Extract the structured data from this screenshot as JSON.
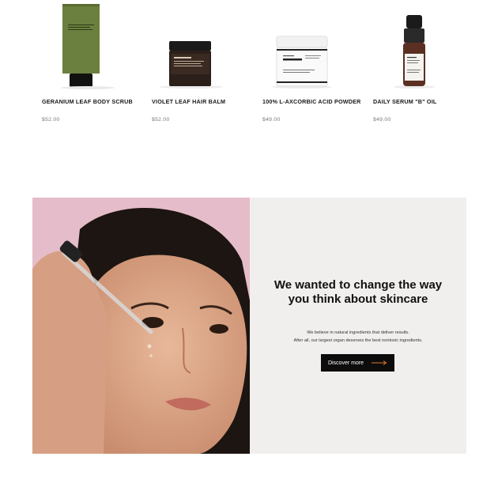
{
  "products": [
    {
      "name": "GERANIUM LEAF BODY SCRUB",
      "price": "$52.00",
      "image_icon": "green-tube-icon",
      "brand_mark": "Aesop"
    },
    {
      "name": "VIOLET LEAF HAIR BALM",
      "price": "$52.00",
      "image_icon": "amber-jar-icon",
      "brand_mark": "Aesop"
    },
    {
      "name": "100% L-AXCORBIC ACID POWDER",
      "price": "$49.00",
      "image_icon": "white-jar-icon",
      "brand_mark": "The Ordinary."
    },
    {
      "name": "DAILY SERUM \"B\" OIL",
      "price": "$49.00",
      "image_icon": "dropper-bottle-icon",
      "brand_mark": "NIOD"
    }
  ],
  "banner": {
    "headline": "We wanted to change the way you think about skincare",
    "subtext_line1": "We believe in natural ingredients that deliver results.",
    "subtext_line2": "After all, our largest organ deserves the best nontoxic ingredients.",
    "cta_label": "Discover more",
    "cta_icon": "arrow-right-icon",
    "image": "woman-applying-serum-photo"
  },
  "colors": {
    "banner_panel": "#f1efed",
    "photo_background": "#e5bcc9",
    "cta_background": "#0c0c0c",
    "cta_arrow": "#e07a2a"
  }
}
